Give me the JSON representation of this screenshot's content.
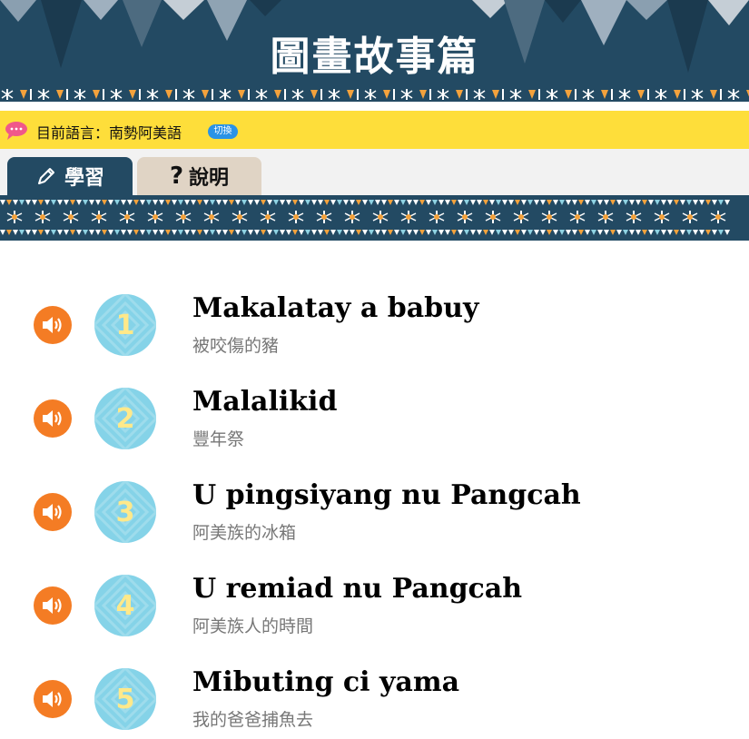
{
  "header": {
    "title": "圖畫故事篇"
  },
  "language_bar": {
    "label": "目前語言：南勢阿美語",
    "switch_label": "切換"
  },
  "tabs": [
    {
      "label": "學習",
      "icon": "pencil-icon",
      "active": true
    },
    {
      "label": "說明",
      "icon": "question-icon",
      "active": false
    }
  ],
  "stories": [
    {
      "number": "1",
      "title": "Makalatay a babuy",
      "subtitle": "被咬傷的豬"
    },
    {
      "number": "2",
      "title": "Malalikid",
      "subtitle": "豐年祭"
    },
    {
      "number": "3",
      "title": "U pingsiyang nu Pangcah",
      "subtitle": "阿美族的冰箱"
    },
    {
      "number": "4",
      "title": "U remiad nu Pangcah",
      "subtitle": "阿美族人的時間"
    },
    {
      "number": "5",
      "title": "Mibuting ci yama",
      "subtitle": "我的爸爸捕魚去"
    }
  ],
  "colors": {
    "header_bg": "#234a63",
    "lang_bar_bg": "#fede3a",
    "switch_bg": "#2a93e6",
    "tab_inactive_bg": "#e0d4c5",
    "sound_button": "#f47c24",
    "number_circle": "#85d3e8",
    "number_text": "#ffe98a"
  }
}
